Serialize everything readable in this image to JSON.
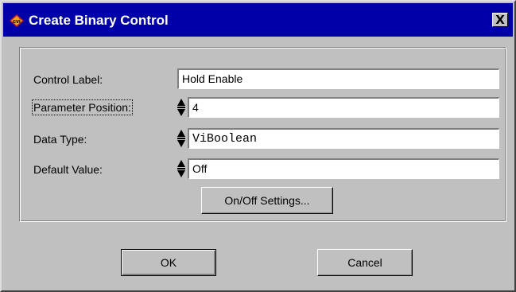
{
  "window": {
    "title": "Create Binary Control",
    "icon": "cvi-icon",
    "close_label": "X"
  },
  "form": {
    "control_label": {
      "label": "Control Label:",
      "value": "Hold Enable"
    },
    "parameter_position": {
      "label": "Parameter Position:",
      "value": "4"
    },
    "data_type": {
      "label": "Data Type:",
      "value": "ViBoolean"
    },
    "default_value": {
      "label": "Default Value:",
      "value": "Off"
    }
  },
  "buttons": {
    "onoff_settings": "On/Off Settings...",
    "ok": "OK",
    "cancel": "Cancel"
  },
  "colors": {
    "titlebar": "#0000a8",
    "dialog": "#c0c0c0",
    "field": "#ffffff"
  }
}
